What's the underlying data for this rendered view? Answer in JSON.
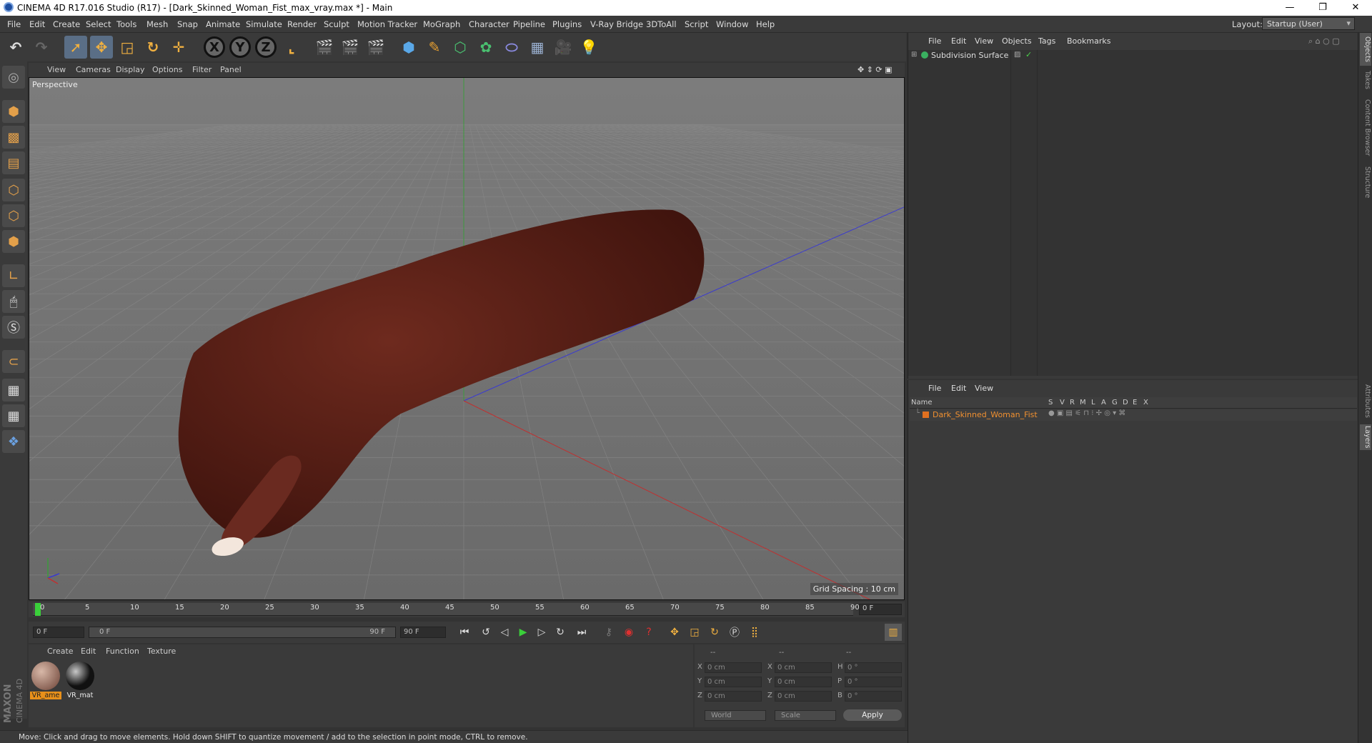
{
  "window": {
    "title": "CINEMA 4D R17.016 Studio (R17) - [Dark_Skinned_Woman_Fist_max_vray.max *] - Main",
    "minimize": "—",
    "restore": "❐",
    "close": "✕"
  },
  "menu": [
    "File",
    "Edit",
    "Create",
    "Select",
    "Tools",
    "Mesh",
    "Snap",
    "Animate",
    "Simulate",
    "Render",
    "Sculpt",
    "Motion Tracker",
    "MoGraph",
    "Character",
    "Pipeline",
    "Plugins",
    "V-Ray Bridge",
    "3DToAll",
    "Script",
    "Window",
    "Help"
  ],
  "layout": {
    "label": "Layout:",
    "value": "Startup (User)"
  },
  "viewport": {
    "menu": [
      "View",
      "Cameras",
      "Display",
      "Options",
      "Filter",
      "Panel"
    ],
    "label": "Perspective",
    "grid_spacing": "Grid Spacing : 10 cm",
    "colors": {
      "background": "#777777",
      "skin": "#5a1f16",
      "nail": "#f3e6dc"
    }
  },
  "timeline": {
    "ticks": [
      "0",
      "5",
      "10",
      "15",
      "20",
      "25",
      "30",
      "35",
      "40",
      "45",
      "50",
      "55",
      "60",
      "65",
      "70",
      "75",
      "80",
      "85",
      "90"
    ],
    "current_frame": "0 F"
  },
  "playbar": {
    "start": "0 F",
    "range_start": "0 F",
    "range_end": "90 F",
    "end": "90 F"
  },
  "material_manager": {
    "menu": [
      "Create",
      "Edit",
      "Function",
      "Texture"
    ],
    "materials": [
      {
        "label": "VR_ame",
        "selected": true
      },
      {
        "label": "VR_mat",
        "selected": false
      }
    ]
  },
  "coordinates": {
    "header": [
      "--",
      "--",
      "--"
    ],
    "rows": [
      {
        "a": "X",
        "av": "0 cm",
        "b": "X",
        "bv": "0 cm",
        "c": "H",
        "cv": "0 °"
      },
      {
        "a": "Y",
        "av": "0 cm",
        "b": "Y",
        "bv": "0 cm",
        "c": "P",
        "cv": "0 °"
      },
      {
        "a": "Z",
        "av": "0 cm",
        "b": "Z",
        "bv": "0 cm",
        "c": "B",
        "cv": "0 °"
      }
    ],
    "world": "World",
    "scale": "Scale",
    "apply": "Apply"
  },
  "status": "Move: Click and drag to move elements. Hold down SHIFT to quantize movement / add to the selection in point mode, CTRL to remove.",
  "maxon": {
    "brand": "MAXON",
    "product": "CINEMA 4D"
  },
  "object_manager": {
    "menu": [
      "File",
      "Edit",
      "View",
      "Objects",
      "Tags",
      "Bookmarks"
    ],
    "objects": [
      {
        "name": "Subdivision Surface"
      }
    ]
  },
  "layer_manager": {
    "menu": [
      "File",
      "Edit",
      "View"
    ],
    "columns": [
      "Name",
      "S",
      "V",
      "R",
      "M",
      "L",
      "A",
      "G",
      "D",
      "E",
      "X"
    ],
    "layers": [
      {
        "name": "Dark_Skinned_Woman_Fist",
        "color": "#e07020"
      }
    ]
  },
  "right_tabs": [
    "Objects",
    "Takes",
    "Content Browser",
    "Structure",
    "Attributes",
    "Layers"
  ]
}
